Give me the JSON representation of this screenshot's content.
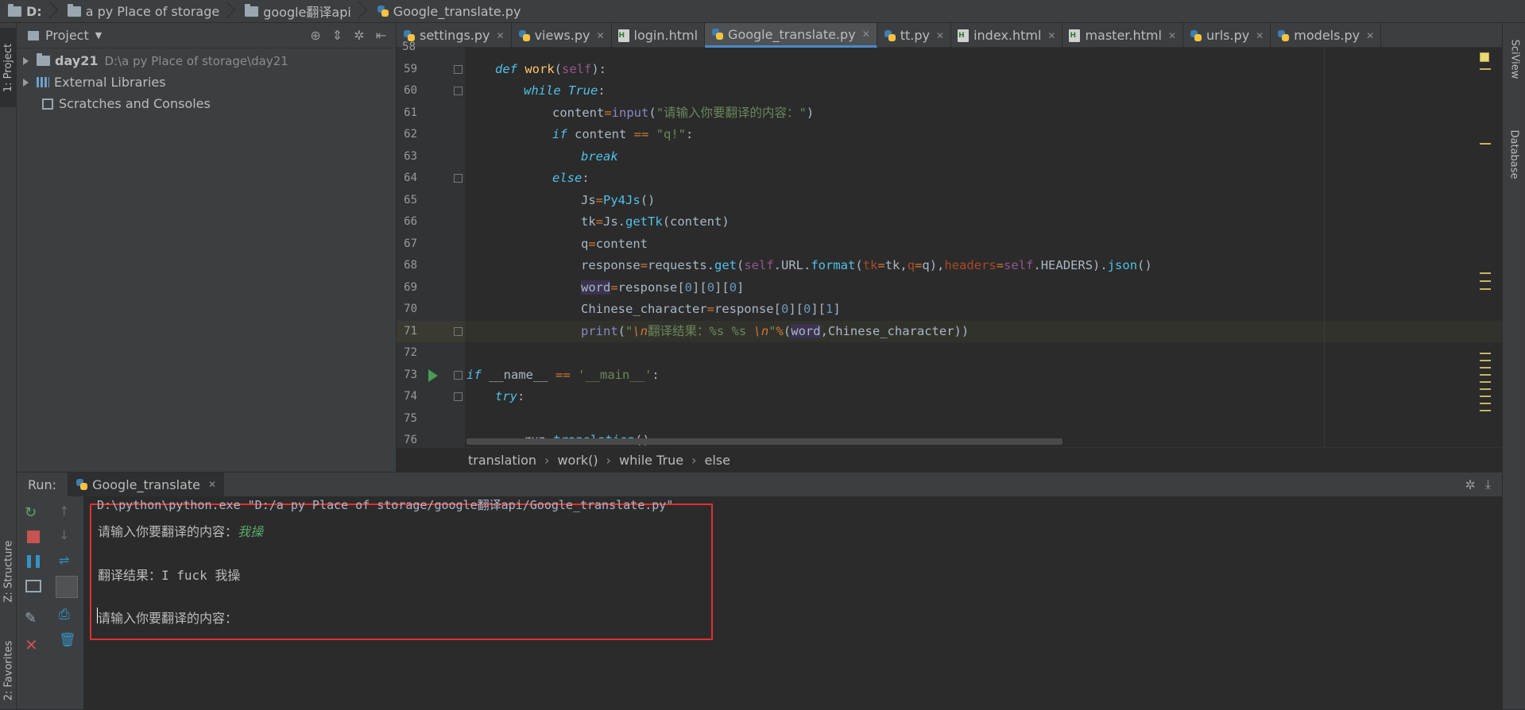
{
  "breadcrumbs": [
    {
      "label": "D:",
      "icon": "folder-icon"
    },
    {
      "label": "a py Place of storage",
      "icon": "folder-icon"
    },
    {
      "label": "google翻译api",
      "icon": "folder-icon"
    },
    {
      "label": "Google_translate.py",
      "icon": "python-file-icon"
    }
  ],
  "left_strip": {
    "project_tab": "1: Project",
    "structure_tab": "Z: Structure",
    "favorites_tab": "2: Favorites"
  },
  "right_strip": {
    "sciview_tab": "SciView",
    "database_tab": "Database"
  },
  "project": {
    "title": "Project",
    "tree": [
      {
        "name": "day21",
        "path": "D:\\a py Place of storage\\day21"
      },
      {
        "name": "External Libraries"
      },
      {
        "name": "Scratches and Consoles"
      }
    ]
  },
  "tabs": [
    {
      "label": "settings.py",
      "type": "py"
    },
    {
      "label": "views.py",
      "type": "py"
    },
    {
      "label": "login.html",
      "type": "html"
    },
    {
      "label": "Google_translate.py",
      "type": "py",
      "active": true
    },
    {
      "label": "tt.py",
      "type": "py"
    },
    {
      "label": "index.html",
      "type": "html"
    },
    {
      "label": "master.html",
      "type": "html"
    },
    {
      "label": "urls.py",
      "type": "py"
    },
    {
      "label": "models.py",
      "type": "py"
    }
  ],
  "editor": {
    "line_numbers": [
      "58",
      "59",
      "60",
      "61",
      "62",
      "63",
      "64",
      "65",
      "66",
      "67",
      "68",
      "69",
      "70",
      "71",
      "72",
      "73",
      "74",
      "75",
      "76"
    ],
    "current_line": "71"
  },
  "code_breadcrumb": [
    "translation",
    "work()",
    "while True",
    "else"
  ],
  "run": {
    "label": "Run:",
    "tab_label": "Google_translate",
    "console": {
      "command": "D:\\python\\python.exe \"D:/a py Place of storage/google翻译api/Google_translate.py\"",
      "prompt1": "请输入你要翻译的内容：",
      "input1": "我操",
      "result": "翻译结果：I fuck 我操",
      "prompt2": "请输入你要翻译的内容："
    }
  },
  "colors": {
    "highlight_box": "#e03030",
    "accent": "#4a88c7"
  }
}
